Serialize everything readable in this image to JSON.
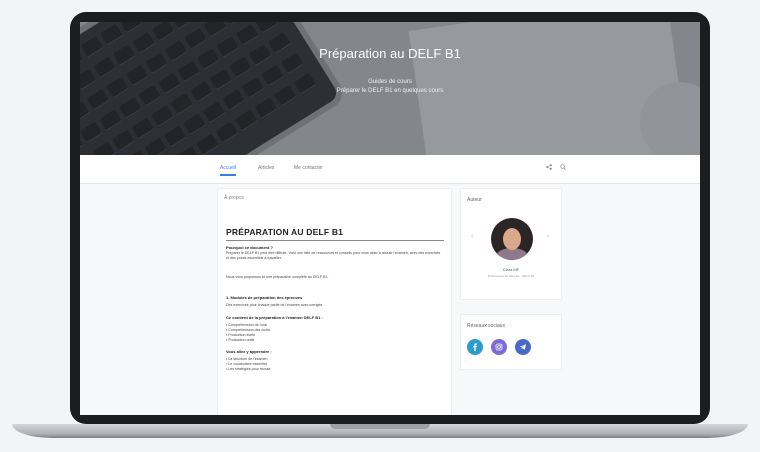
{
  "hero": {
    "title": "Préparation au DELF B1",
    "subtitle_line1": "Guides de cours",
    "subtitle_line2": "Préparer le DELF B1 en quelques cours"
  },
  "nav": {
    "tabs": [
      {
        "label": "Accueil",
        "active": true
      },
      {
        "label": "Articles",
        "active": false
      },
      {
        "label": "Me contacter",
        "active": false
      }
    ]
  },
  "post": {
    "breadcrumb": "À propos",
    "title": "PRÉPARATION AU DELF B1",
    "question": "Pourquoi ce document ?",
    "intro": "Préparer le DELF B1 peut être difficile. Voici une liste de ressources et conseils pour vous aider à réussir l'examen, avec des exercices et des points essentiels à travailler.",
    "note": "Nous vous proposons ici une préparation complète au DELF B1.",
    "section1_title": "1. Modules de préparation des épreuves",
    "section1_text": "Des exercices pour chaque partie de l'examen avec corrigés.",
    "section2_title": "Ce contient de la préparation à l'examen DELF B1 :",
    "section2_items": [
      "Compréhension de l'oral",
      "Compréhension des écrits",
      "Production écrite",
      "Production orale"
    ],
    "section3_title": "Vous allez y apprendre :",
    "section3_items": [
      "La structure de l'examen",
      "Le vocabulaire essentiel",
      "Les stratégies pour réussir"
    ]
  },
  "sidebar": {
    "author_heading": "Auteur",
    "author_name": "Clara MF",
    "author_role": "Professeure de français · DELF B1",
    "social_heading": "Réseaux sociaux",
    "social_icons": [
      "facebook-icon",
      "instagram-icon",
      "telegram-icon"
    ],
    "social_colors": [
      "#2d9ccc",
      "#7b6ad8",
      "#4a68c8"
    ]
  },
  "device": {
    "model": "MacBook Pro"
  }
}
